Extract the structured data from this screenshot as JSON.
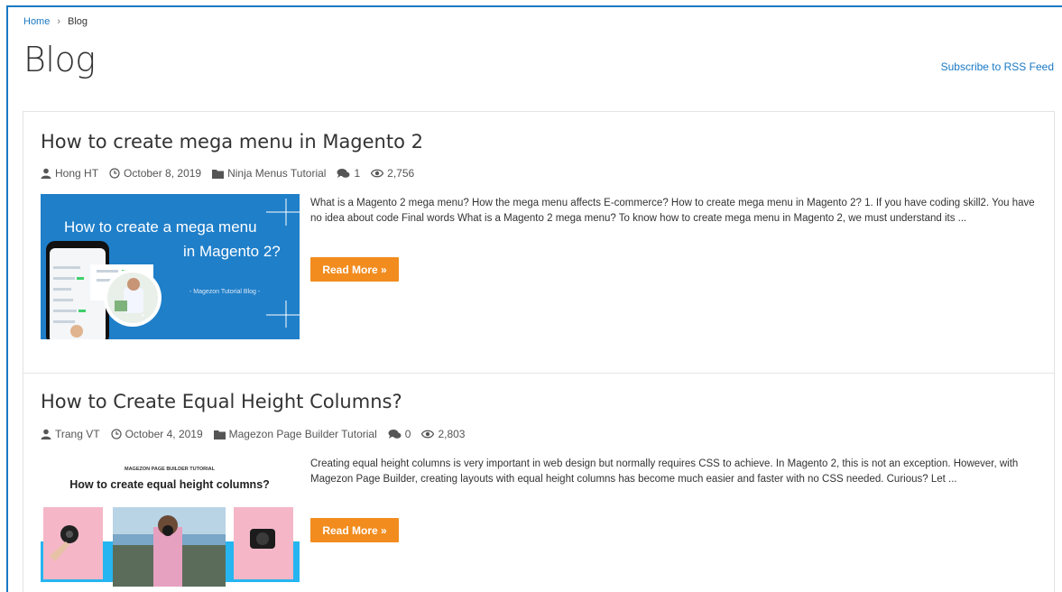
{
  "breadcrumb": {
    "home": "Home",
    "separator": "›",
    "current": "Blog"
  },
  "page": {
    "title": "Blog",
    "rss_link": "Subscribe to RSS Feed"
  },
  "colors": {
    "link": "#1979c3",
    "read_more_bg": "#f28c1e",
    "thumb1_bg": "#1f7fc9"
  },
  "posts": [
    {
      "title": "How to create mega menu in Magento 2",
      "author": "Hong HT",
      "date": "October 8, 2019",
      "category": "Ninja Menus Tutorial",
      "comments": "1",
      "views": "2,756",
      "excerpt": "What is a Magento 2 mega menu? How the mega menu affects E-commerce? How to create mega menu in Magento 2? 1. If you have coding skill2. You have no idea about code Final words What is a Magento 2 mega menu? To know how to create mega menu in Magento 2, we must understand its ...",
      "read_more": "Read More »",
      "thumb": {
        "line1": "How to create a mega menu",
        "line2": "in Magento 2?",
        "tag": "- Magezon Tutorial Blog -"
      }
    },
    {
      "title": "How to Create Equal Height Columns?",
      "author": "Trang VT",
      "date": "October 4, 2019",
      "category": "Magezon Page Builder Tutorial",
      "comments": "0",
      "views": "2,803",
      "excerpt": "Creating equal height columns is very important in web design but normally requires CSS to achieve. In Magento 2, this is not an exception.  However, with Magezon Page Builder, creating layouts with equal height columns has become much easier and faster with no CSS needed. Curious? Let ...",
      "read_more": "Read More »",
      "thumb": {
        "kicker": "MAGEZON PAGE BUILDER TUTORIAL",
        "heading": "How to create equal height columns?"
      }
    }
  ]
}
